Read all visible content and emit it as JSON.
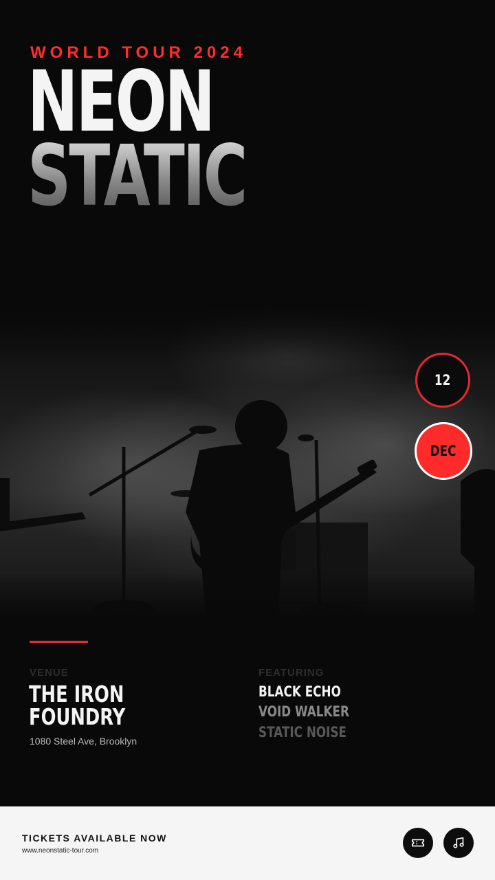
{
  "header": {
    "eyebrow": "WORLD TOUR 2024",
    "title_line1": "NEON",
    "title_line2": "STATIC"
  },
  "date": {
    "day": "12",
    "month": "DEC"
  },
  "venue": {
    "label": "VENUE",
    "name_line1": "THE IRON",
    "name_line2": "FOUNDRY",
    "address": "1080 Steel Ave, Brooklyn"
  },
  "featuring": {
    "label": "FEATURING",
    "artists": [
      "BLACK ECHO",
      "VOID WALKER",
      "STATIC NOISE"
    ]
  },
  "footer": {
    "cta": "TICKETS AVAILABLE NOW",
    "url": "www.neonstatic-tour.com",
    "icons": [
      "ticket-icon",
      "music-note-icon"
    ]
  },
  "colors": {
    "accent": "#ff2d2d",
    "background": "#090909",
    "footer_bg": "#f5f5f5"
  }
}
